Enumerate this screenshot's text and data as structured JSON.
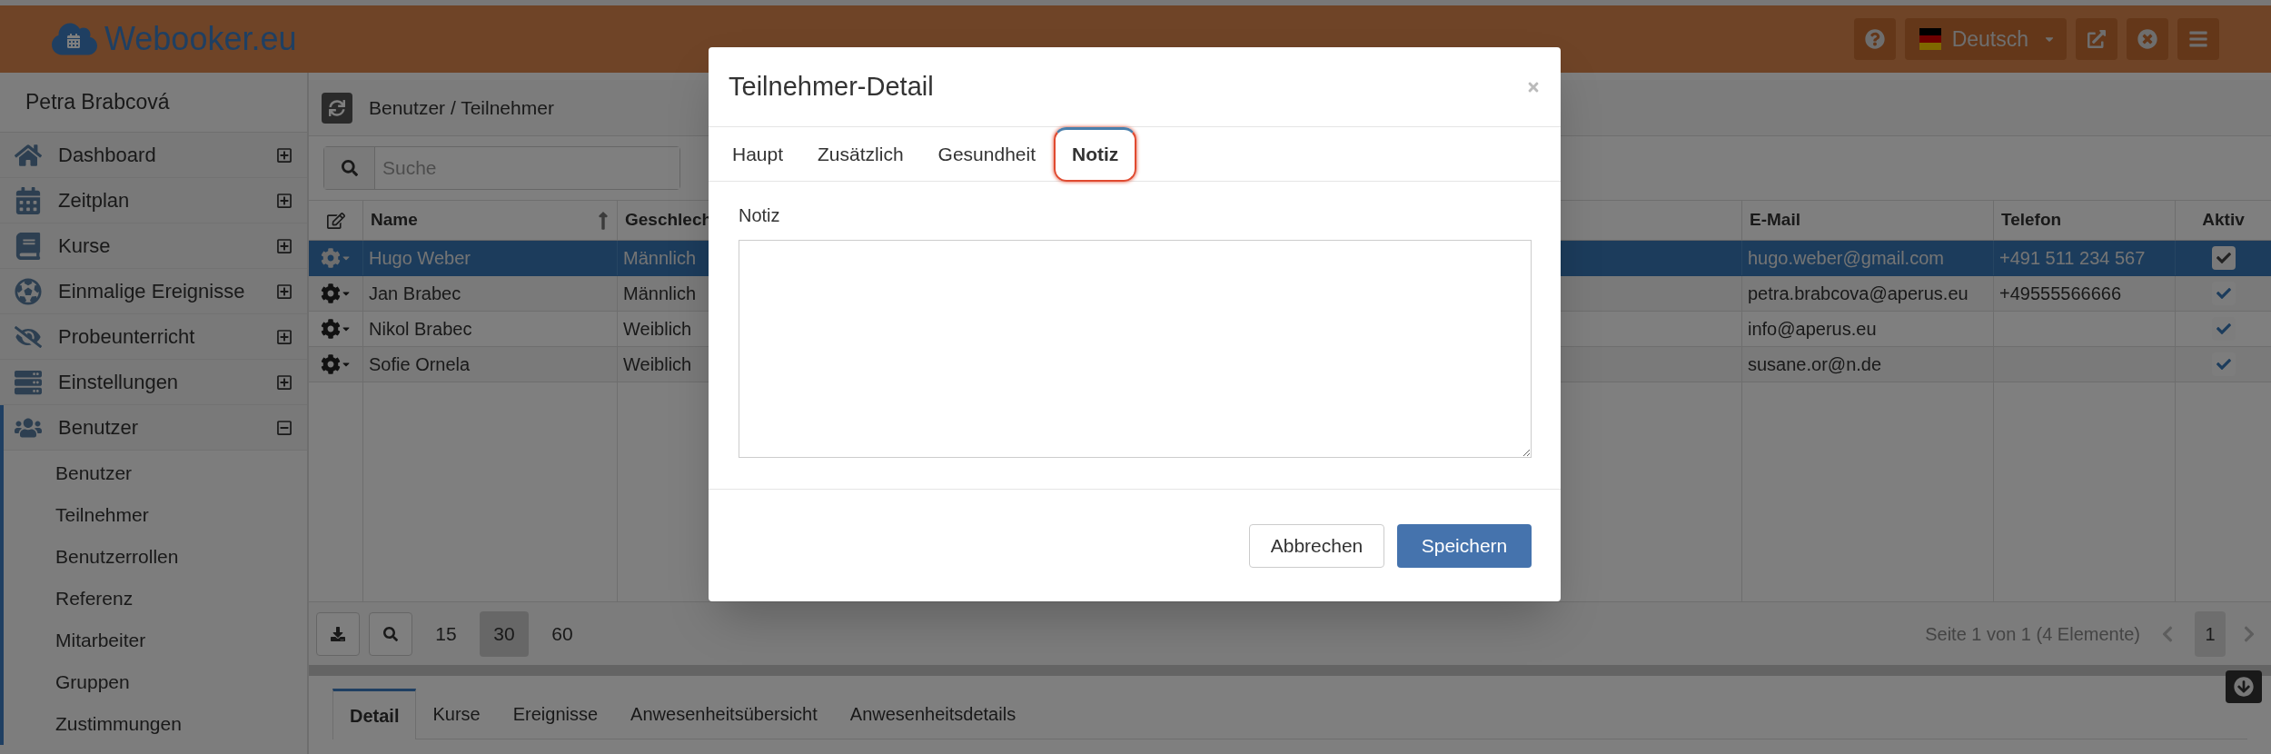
{
  "app": {
    "logo": "Webooker.eu",
    "language": "Deutsch"
  },
  "sidebar": {
    "user": "Petra Brabcová",
    "items": [
      {
        "label": "Dashboard",
        "expanded": false
      },
      {
        "label": "Zeitplan",
        "expanded": false
      },
      {
        "label": "Kurse",
        "expanded": false
      },
      {
        "label": "Einmalige Ereignisse",
        "expanded": false
      },
      {
        "label": "Probeunterricht",
        "expanded": false
      },
      {
        "label": "Einstellungen",
        "expanded": false
      },
      {
        "label": "Benutzer",
        "expanded": true,
        "children": [
          {
            "label": "Benutzer"
          },
          {
            "label": "Teilnehmer"
          },
          {
            "label": "Benutzerrollen"
          },
          {
            "label": "Referenz"
          },
          {
            "label": "Mitarbeiter"
          },
          {
            "label": "Gruppen"
          },
          {
            "label": "Zustimmungen"
          }
        ]
      }
    ]
  },
  "breadcrumb": "Benutzer / Teilnehmer",
  "search": {
    "placeholder": "Suche"
  },
  "table": {
    "columns": [
      "Name",
      "Geschlech",
      "E-Mail",
      "Telefon",
      "Aktiv"
    ],
    "rows": [
      {
        "name": "Hugo Weber",
        "gender": "Männlich",
        "email": "hugo.weber@gmail.com",
        "phone": "+491 511 234 567",
        "active": true,
        "selected": true
      },
      {
        "name": "Jan Brabec",
        "gender": "Männlich",
        "email": "petra.brabcova@aperus.eu",
        "phone": "+49555566666",
        "active": true,
        "selected": false
      },
      {
        "name": "Nikol Brabec",
        "gender": "Weiblich",
        "email": "info@aperus.eu",
        "active": true,
        "selected": false
      },
      {
        "name": "Sofie Ornela",
        "gender": "Weiblich",
        "email": "susane.or@n.de",
        "active": true,
        "selected": false
      }
    ]
  },
  "pagination": {
    "sizes": [
      {
        "label": "15",
        "selected": false
      },
      {
        "label": "30",
        "selected": true
      },
      {
        "label": "60",
        "selected": false
      }
    ],
    "summary": "Seite 1 von 1 (4 Elemente)",
    "pages": [
      {
        "label": "1",
        "selected": true
      }
    ]
  },
  "detail_tabs": [
    {
      "label": "Detail",
      "selected": true
    },
    {
      "label": "Kurse",
      "selected": false
    },
    {
      "label": "Ereignisse",
      "selected": false
    },
    {
      "label": "Anwesenheitsübersicht",
      "selected": false
    },
    {
      "label": "Anwesenheitsdetails",
      "selected": false
    }
  ],
  "modal": {
    "title": "Teilnehmer-Detail",
    "tabs": [
      {
        "label": "Haupt",
        "selected": false,
        "highlighted": false
      },
      {
        "label": "Zusätzlich",
        "selected": false,
        "highlighted": false
      },
      {
        "label": "Gesundheit",
        "selected": false,
        "highlighted": false
      },
      {
        "label": "Notiz",
        "selected": true,
        "highlighted": true
      }
    ],
    "field_label": "Notiz",
    "buttons": [
      {
        "label": "Abbrechen",
        "kind": "secondary"
      },
      {
        "label": "Speichern",
        "kind": "primary"
      }
    ]
  }
}
